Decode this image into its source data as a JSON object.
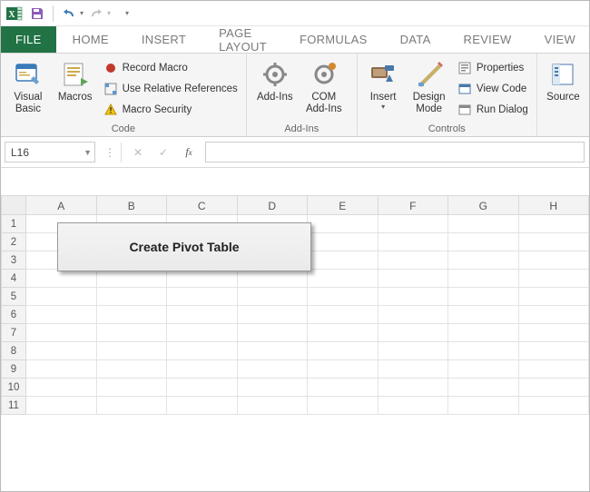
{
  "qat": {
    "undo_tip": "Undo",
    "redo_tip": "Redo"
  },
  "tabs": {
    "file": "FILE",
    "items": [
      "HOME",
      "INSERT",
      "PAGE LAYOUT",
      "FORMULAS",
      "DATA",
      "REVIEW",
      "VIEW"
    ]
  },
  "ribbon": {
    "code": {
      "label": "Code",
      "visual_basic": "Visual Basic",
      "macros": "Macros",
      "record_macro": "Record Macro",
      "use_relative": "Use Relative References",
      "macro_security": "Macro Security"
    },
    "addins": {
      "label": "Add-Ins",
      "addins": "Add-Ins",
      "com_addins": "COM Add-Ins"
    },
    "controls": {
      "label": "Controls",
      "insert": "Insert",
      "design_mode": "Design Mode",
      "properties": "Properties",
      "view_code": "View Code",
      "run_dialog": "Run Dialog"
    },
    "source": {
      "source": "Source"
    }
  },
  "namebox": {
    "value": "L16"
  },
  "columns": [
    "A",
    "B",
    "C",
    "D",
    "E",
    "F",
    "G",
    "H"
  ],
  "rows": [
    "1",
    "2",
    "3",
    "4",
    "5",
    "6",
    "7",
    "8",
    "9",
    "10",
    "11"
  ],
  "sheet_button": {
    "label": "Create Pivot Table"
  }
}
